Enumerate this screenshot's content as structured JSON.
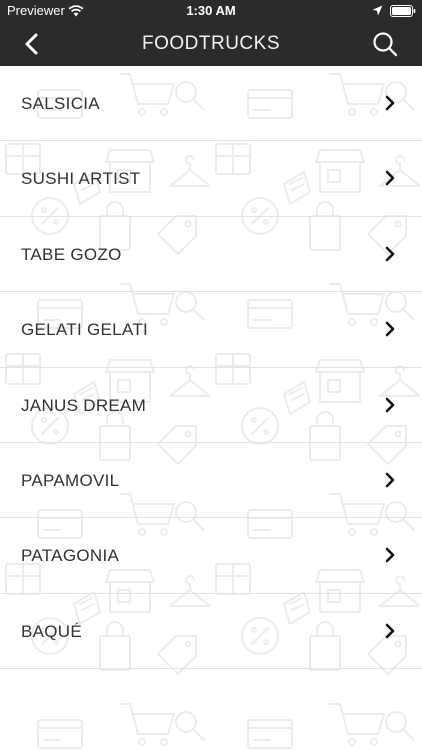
{
  "status_bar": {
    "carrier": "Previewer",
    "time": "1:30 AM"
  },
  "nav": {
    "title": "FOODTRUCKS",
    "back_icon": "chevron-left-icon",
    "search_icon": "search-icon"
  },
  "colors": {
    "bar_background": "#2b2b2b",
    "list_text": "#333333",
    "divider": "#e3e3e3",
    "pattern": "#ececec"
  },
  "items": [
    {
      "label": "SALSICIA"
    },
    {
      "label": "SUSHI ARTIST"
    },
    {
      "label": "TABE GOZO"
    },
    {
      "label": "GELATI GELATI"
    },
    {
      "label": "JANUS DREAM"
    },
    {
      "label": "PAPAMOVIL"
    },
    {
      "label": "PATAGONIA"
    },
    {
      "label": "BAQUÉ"
    }
  ]
}
